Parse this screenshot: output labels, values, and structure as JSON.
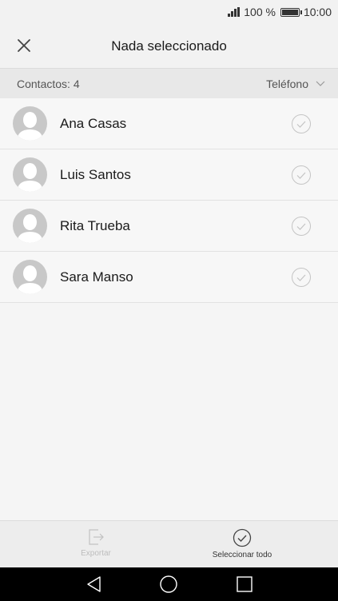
{
  "status_bar": {
    "battery_text": "100 %",
    "time": "10:00"
  },
  "header": {
    "title": "Nada seleccionado"
  },
  "subheader": {
    "count_label": "Contactos: 4",
    "filter_label": "Teléfono"
  },
  "contacts": [
    {
      "name": "Ana Casas"
    },
    {
      "name": "Luis Santos"
    },
    {
      "name": "Rita Trueba"
    },
    {
      "name": "Sara Manso"
    }
  ],
  "bottom_actions": {
    "export_label": "Exportar",
    "select_all_label": "Seleccionar todo"
  },
  "icons": {
    "close": "close-icon",
    "dropdown": "chevron-down-icon",
    "avatar": "person-avatar-icon",
    "check": "check-circle-icon",
    "export": "export-icon",
    "select_all": "select-all-icon",
    "nav_back": "back-triangle-icon",
    "nav_home": "home-circle-icon",
    "nav_recents": "recents-square-icon"
  },
  "colors": {
    "background": "#f5f5f5",
    "header": "#f2f2f2",
    "subheader": "#e8e8e8",
    "nav_bar": "#000000",
    "avatar_bg": "#c8c8c8"
  }
}
